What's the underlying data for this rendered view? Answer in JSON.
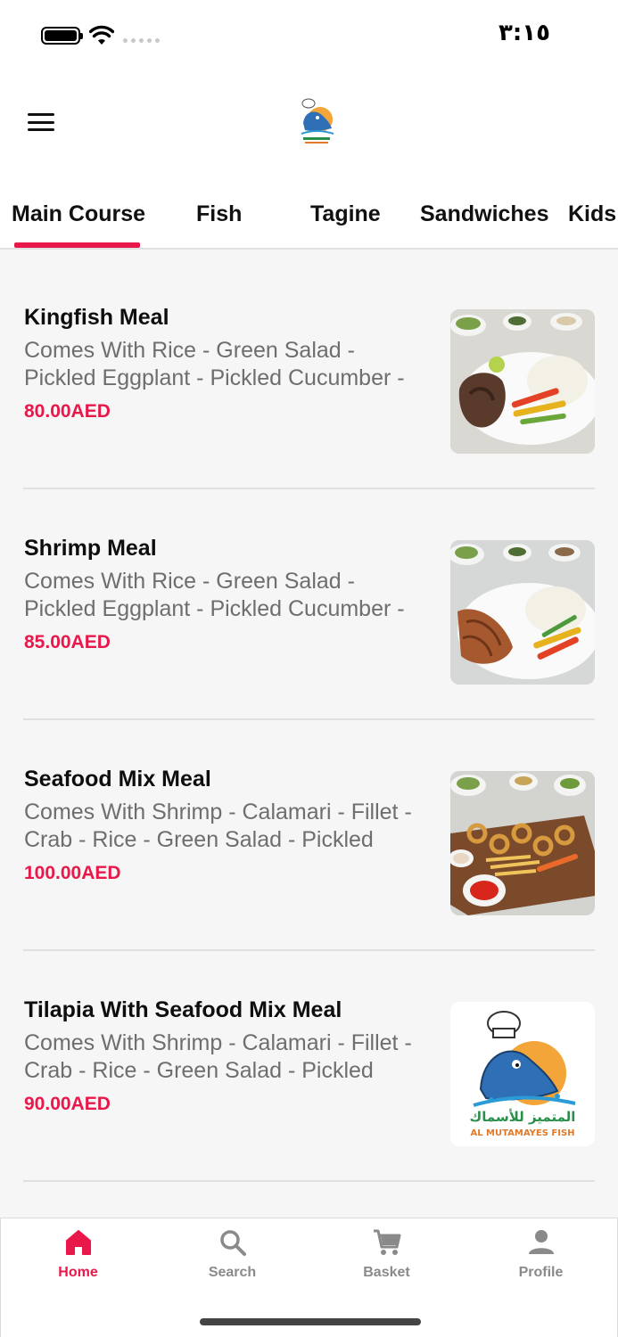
{
  "status_bar": {
    "time": "٣:١٥"
  },
  "header": {
    "logo_text": "المتميز للأسماك",
    "logo_text_en": "AL MUTAMAYES FISH"
  },
  "tabs": [
    {
      "label": "Main Course",
      "active": true
    },
    {
      "label": "Fish",
      "active": false
    },
    {
      "label": "Tagine",
      "active": false
    },
    {
      "label": "Sandwiches",
      "active": false
    },
    {
      "label": "Kids",
      "active": false
    }
  ],
  "items": [
    {
      "title": "Kingfish Meal",
      "desc_line1": "Comes With Rice - Green Salad -",
      "desc_line2": "Pickled Eggplant - Pickled Cucumber -",
      "price": "80.00AED",
      "image": "kingfish-meal-photo"
    },
    {
      "title": "Shrimp Meal",
      "desc_line1": "Comes With Rice - Green Salad -",
      "desc_line2": "Pickled Eggplant - Pickled Cucumber -",
      "price": "85.00AED",
      "image": "shrimp-meal-photo"
    },
    {
      "title": "Seafood Mix Meal",
      "desc_line1": "Comes With Shrimp - Calamari - Fillet -",
      "desc_line2": "Crab - Rice - Green Salad - Pickled",
      "price": "100.00AED",
      "image": "seafood-mix-photo"
    },
    {
      "title": "Tilapia With Seafood Mix Meal",
      "desc_line1": "Comes With Shrimp - Calamari - Fillet -",
      "desc_line2": "Crab - Rice - Green Salad - Pickled",
      "price": "90.00AED",
      "image": "restaurant-logo"
    }
  ],
  "bottom_nav": [
    {
      "label": "Home",
      "icon": "home-icon",
      "active": true
    },
    {
      "label": "Search",
      "icon": "search-icon",
      "active": false
    },
    {
      "label": "Basket",
      "icon": "cart-icon",
      "active": false
    },
    {
      "label": "Profile",
      "icon": "person-icon",
      "active": false
    }
  ],
  "colors": {
    "accent": "#e8184a",
    "text": "#111111",
    "muted": "#6e6e6e",
    "background": "#f6f6f6"
  }
}
